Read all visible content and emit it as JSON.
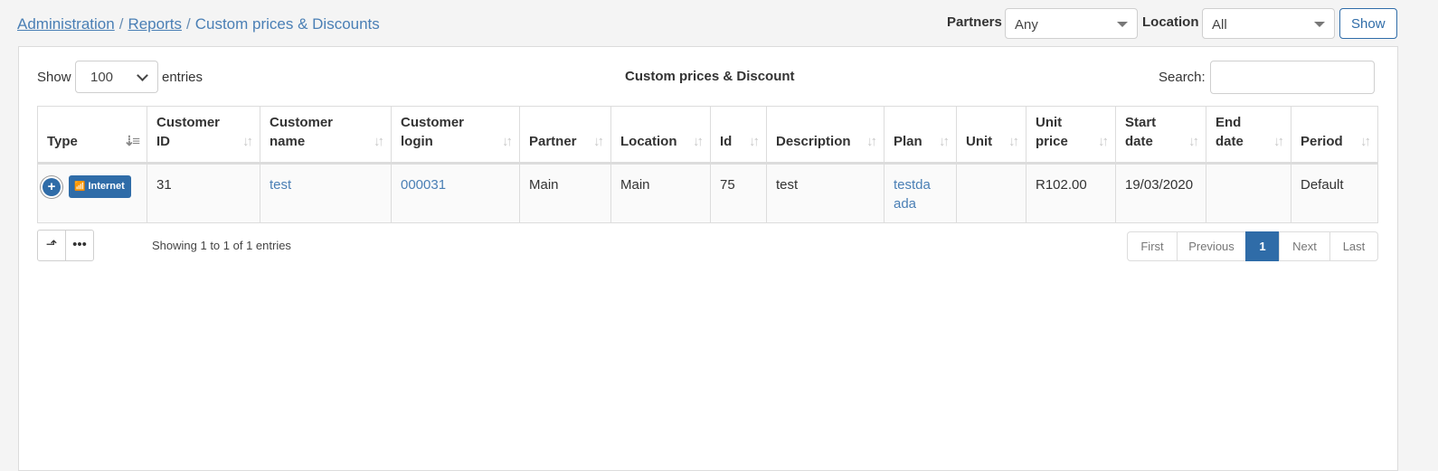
{
  "breadcrumb": {
    "items": [
      "Administration",
      "Reports"
    ],
    "separator": "/",
    "current": "Custom prices & Discounts"
  },
  "filters": {
    "partners_label": "Partners",
    "partners_value": "Any",
    "location_label": "Location",
    "location_value": "All",
    "show_button": "Show"
  },
  "table_controls": {
    "show_label": "Show",
    "entries_value": "100",
    "entries_label": "entries",
    "title": "Custom prices & Discount",
    "search_label": "Search:",
    "search_value": ""
  },
  "table": {
    "columns": [
      {
        "l1": "Type",
        "l2": ""
      },
      {
        "l1": "Customer",
        "l2": "ID"
      },
      {
        "l1": "Customer",
        "l2": "name"
      },
      {
        "l1": "Customer",
        "l2": "login"
      },
      {
        "l1": "Partner",
        "l2": ""
      },
      {
        "l1": "Location",
        "l2": ""
      },
      {
        "l1": "Id",
        "l2": ""
      },
      {
        "l1": "Description",
        "l2": ""
      },
      {
        "l1": "Plan",
        "l2": ""
      },
      {
        "l1": "Unit",
        "l2": ""
      },
      {
        "l1": "Unit",
        "l2": "price"
      },
      {
        "l1": "Start",
        "l2": "date"
      },
      {
        "l1": "End",
        "l2": "date"
      },
      {
        "l1": "Period",
        "l2": ""
      }
    ],
    "rows": [
      {
        "type_badge": "Internet",
        "customer_id": "31",
        "customer_name": "test",
        "customer_login": "000031",
        "partner": "Main",
        "location": "Main",
        "id": "75",
        "description": "test",
        "plan_l1": "testda",
        "plan_l2": "ada",
        "unit": "",
        "unit_price": "R102.00",
        "start_date": "19/03/2020",
        "end_date": "",
        "period": "Default"
      }
    ]
  },
  "footer": {
    "info": "Showing 1 to 1 of 1 entries",
    "pager": [
      "First",
      "Previous",
      "1",
      "Next",
      "Last"
    ]
  },
  "colors": {
    "accent": "#2f6ca8",
    "link": "#4a7fb5"
  }
}
